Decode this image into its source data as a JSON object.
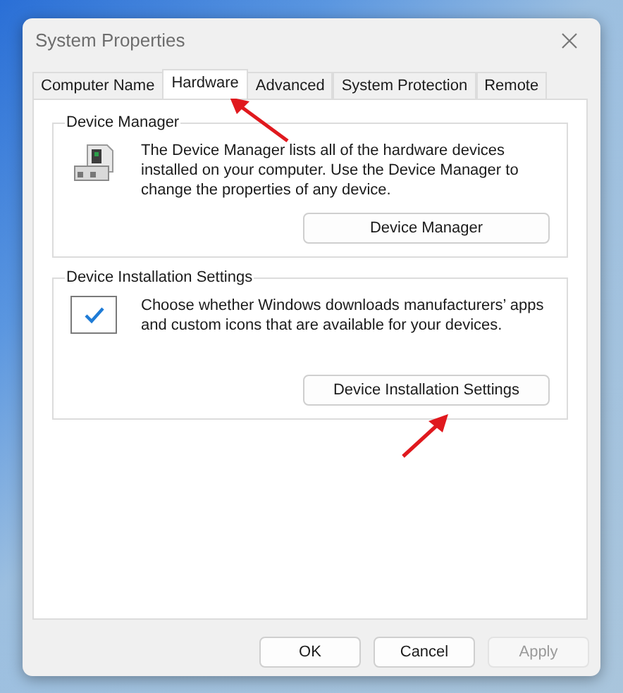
{
  "window": {
    "title": "System Properties"
  },
  "tabs": [
    {
      "label": "Computer Name",
      "selected": false
    },
    {
      "label": "Hardware",
      "selected": true
    },
    {
      "label": "Advanced",
      "selected": false
    },
    {
      "label": "System Protection",
      "selected": false
    },
    {
      "label": "Remote",
      "selected": false
    }
  ],
  "groups": [
    {
      "kind": "device-manager",
      "title": "Device Manager",
      "text": "The Device Manager lists all of the hardware devices installed on your computer. Use the Device Manager to change the properties of any device.",
      "button": "Device Manager"
    },
    {
      "kind": "installation",
      "title": "Device Installation Settings",
      "text": "Choose whether Windows downloads manufacturers’ apps and custom icons that are available for your devices.",
      "button": "Device Installation Settings"
    }
  ],
  "buttons": [
    {
      "label": "OK",
      "disabled": false
    },
    {
      "label": "Cancel",
      "disabled": false
    },
    {
      "label": "Apply",
      "disabled": true
    }
  ]
}
